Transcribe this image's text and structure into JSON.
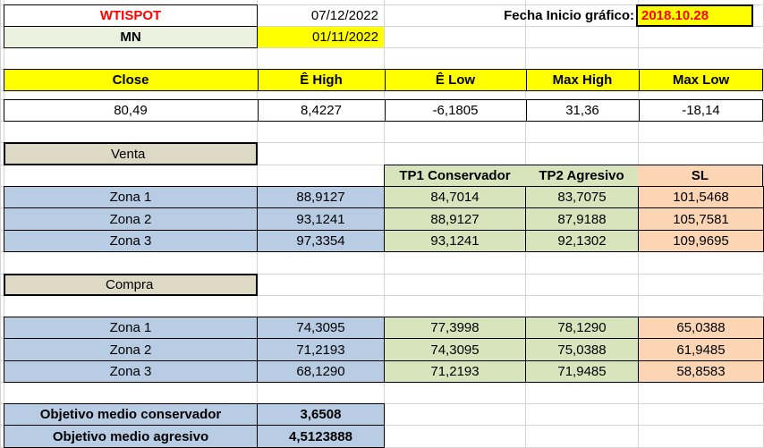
{
  "header": {
    "symbol": "WTISPOT",
    "date": "07/12/2022",
    "timeframe": "MN",
    "period_date": "01/11/2022",
    "chart_start_label": "Fecha Inicio gráfico:",
    "chart_start_value": "2018.10.28"
  },
  "metrics": {
    "headers": [
      "Close",
      "Ê High",
      "Ê Low",
      "Max High",
      "Max Low"
    ],
    "values": [
      "80,49",
      "8,4227",
      "-6,1805",
      "31,36",
      "-18,14"
    ]
  },
  "targets_header": [
    "TP1 Conservador",
    "TP2 Agresivo",
    "SL"
  ],
  "venta": {
    "label": "Venta",
    "rows": [
      {
        "zone": "Zona 1",
        "entry": "88,9127",
        "tp1": "84,7014",
        "tp2": "83,7075",
        "sl": "101,5468"
      },
      {
        "zone": "Zona 2",
        "entry": "93,1241",
        "tp1": "88,9127",
        "tp2": "87,9188",
        "sl": "105,7581"
      },
      {
        "zone": "Zona 3",
        "entry": "97,3354",
        "tp1": "93,1241",
        "tp2": "92,1302",
        "sl": "109,9695"
      }
    ]
  },
  "compra": {
    "label": "Compra",
    "rows": [
      {
        "zone": "Zona 1",
        "entry": "74,3095",
        "tp1": "77,3998",
        "tp2": "78,1290",
        "sl": "65,0388"
      },
      {
        "zone": "Zona 2",
        "entry": "71,2193",
        "tp1": "74,3095",
        "tp2": "75,0388",
        "sl": "61,9485"
      },
      {
        "zone": "Zona 3",
        "entry": "68,1290",
        "tp1": "71,2193",
        "tp2": "71,9485",
        "sl": "58,8583"
      }
    ]
  },
  "objectives": {
    "conservative_label": "Objetivo medio conservador",
    "conservative_value": "3,6508",
    "aggressive_label": "Objetivo medio agresivo",
    "aggressive_value": "4,5123888"
  },
  "colors": {
    "red_text": "#ff0000",
    "yellow": "#ffff00",
    "blue": "#b8cce4",
    "green": "#d8e4bc",
    "peach": "#fcd5b4",
    "tan": "#ddd9c4"
  }
}
